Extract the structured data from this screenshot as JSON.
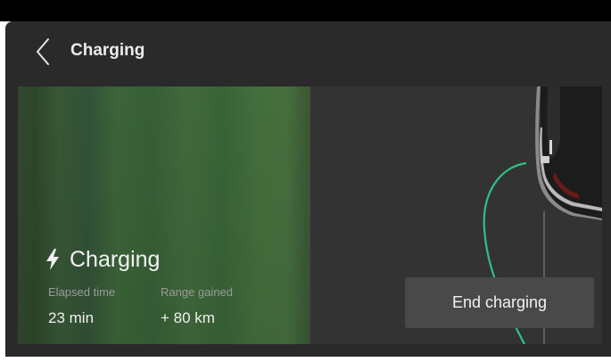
{
  "header": {
    "back_icon": "chevron-left-icon",
    "title": "Charging"
  },
  "status": {
    "icon": "lightning-bolt-icon",
    "label": "Charging"
  },
  "stats": {
    "elapsed": {
      "label": "Elapsed time",
      "value": "23 min"
    },
    "range": {
      "label": "Range gained",
      "value": "+ 80 km"
    }
  },
  "actions": {
    "end_charging_label": "End charging"
  },
  "colors": {
    "background": "#2a2a2a",
    "charge_green": "#3f6a3b",
    "cable_green": "#2fbf84",
    "button": "#494949"
  }
}
